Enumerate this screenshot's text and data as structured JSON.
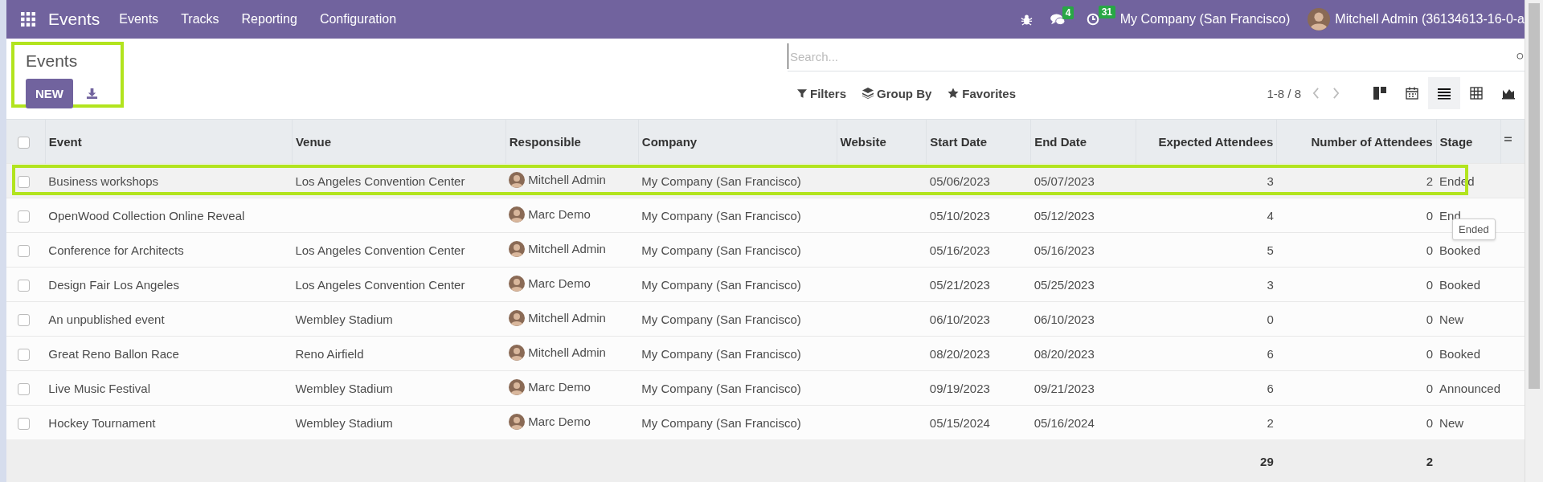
{
  "navbar": {
    "app_name": "Events",
    "menu": [
      "Events",
      "Tracks",
      "Reporting",
      "Configuration"
    ],
    "messages_badge": "4",
    "activities_badge": "31",
    "company": "My Company (San Francisco)",
    "user": "Mitchell Admin (36134613-16-0-a"
  },
  "control_panel": {
    "title": "Events",
    "new_button": "NEW",
    "annotated": true,
    "search": {
      "placeholder": "Search..."
    },
    "filters": [
      {
        "kind": "filter",
        "label": "Filters"
      },
      {
        "kind": "group",
        "label": "Group By"
      },
      {
        "kind": "favorite",
        "label": "Favorites"
      }
    ],
    "pager": "1-8 / 8",
    "views": [
      {
        "kind": "kanban",
        "selected": false
      },
      {
        "kind": "calendar",
        "selected": false
      },
      {
        "kind": "list",
        "selected": true
      },
      {
        "kind": "pivot",
        "selected": false
      },
      {
        "kind": "graph",
        "selected": false
      }
    ]
  },
  "table": {
    "select_all": {
      "checked": false
    },
    "columns": [
      {
        "label": "Event"
      },
      {
        "label": "Venue"
      },
      {
        "label": "Responsible"
      },
      {
        "label": "Company"
      },
      {
        "label": "Website"
      },
      {
        "label": "Start Date"
      },
      {
        "label": "End Date"
      },
      {
        "label": "Expected Attendees"
      },
      {
        "label": "Number of Attendees"
      },
      {
        "label": "Stage"
      }
    ],
    "rows": [
      {
        "checked": false,
        "annotated": true,
        "event": "Business workshops",
        "venue": "Los Angeles Convention Center",
        "responsible": "Mitchell Admin",
        "company": "My Company (San Francisco)",
        "start": "05/06/2023",
        "end": "05/07/2023",
        "expected": "3",
        "number": "2",
        "stage": "Ended"
      },
      {
        "checked": false,
        "annotated": false,
        "event": "OpenWood Collection Online Reveal",
        "responsible": "Marc Demo",
        "company": "My Company (San Francisco)",
        "start": "05/10/2023",
        "end": "05/12/2023",
        "expected": "4",
        "number": "0",
        "stage": "End",
        "tooltip": "Ended"
      },
      {
        "checked": false,
        "annotated": false,
        "event": "Conference for Architects",
        "venue": "Los Angeles Convention Center",
        "responsible": "Mitchell Admin",
        "company": "My Company (San Francisco)",
        "start": "05/16/2023",
        "end": "05/16/2023",
        "expected": "5",
        "number": "0",
        "stage": "Booked"
      },
      {
        "checked": false,
        "annotated": false,
        "event": "Design Fair Los Angeles",
        "venue": "Los Angeles Convention Center",
        "responsible": "Marc Demo",
        "company": "My Company (San Francisco)",
        "start": "05/21/2023",
        "end": "05/25/2023",
        "expected": "3",
        "number": "0",
        "stage": "Booked"
      },
      {
        "checked": false,
        "annotated": false,
        "event": "An unpublished event",
        "venue": "Wembley Stadium",
        "responsible": "Mitchell Admin",
        "company": "My Company (San Francisco)",
        "start": "06/10/2023",
        "end": "06/10/2023",
        "expected": "0",
        "number": "0",
        "stage": "New"
      },
      {
        "checked": false,
        "annotated": false,
        "event": "Great Reno Ballon Race",
        "venue": "Reno Airfield",
        "responsible": "Mitchell Admin",
        "company": "My Company (San Francisco)",
        "start": "08/20/2023",
        "end": "08/20/2023",
        "expected": "6",
        "number": "0",
        "stage": "Booked"
      },
      {
        "checked": false,
        "annotated": false,
        "event": "Live Music Festival",
        "venue": "Wembley Stadium",
        "responsible": "Marc Demo",
        "company": "My Company (San Francisco)",
        "start": "09/19/2023",
        "end": "09/21/2023",
        "expected": "6",
        "number": "0",
        "stage": "Announced"
      },
      {
        "checked": false,
        "annotated": false,
        "event": "Hockey Tournament",
        "venue": "Wembley Stadium",
        "responsible": "Marc Demo",
        "company": "My Company (San Francisco)",
        "start": "05/15/2024",
        "end": "05/16/2024",
        "expected": "2",
        "number": "0",
        "stage": "New"
      }
    ],
    "totals": {
      "expected": "29",
      "number": "2"
    }
  }
}
